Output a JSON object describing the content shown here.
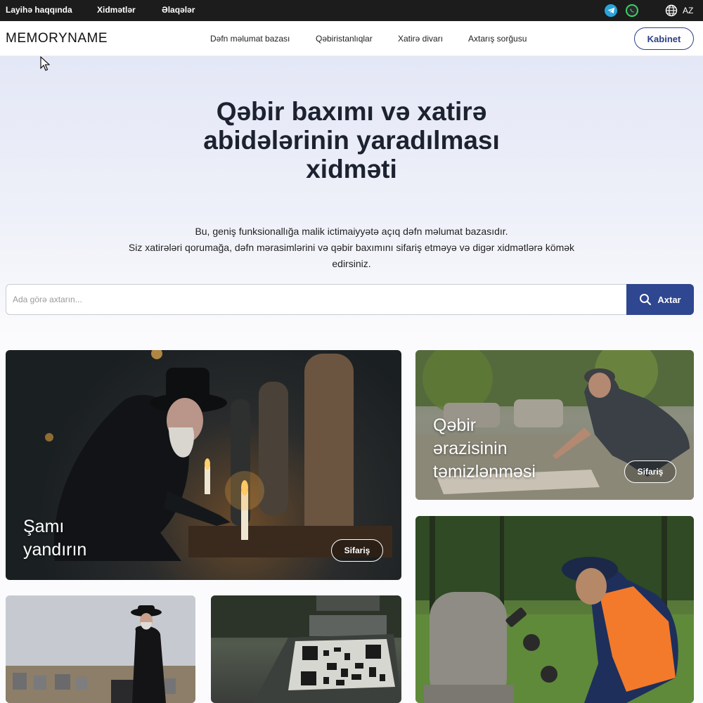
{
  "topbar": {
    "links": [
      "Layihə haqqında",
      "Xidmətlər",
      "Əlaqələr"
    ],
    "language": "AZ",
    "telegram_color": "#2aa3dc",
    "whatsapp_color": "#38d36a"
  },
  "header": {
    "logo": "MEMORYNAME",
    "nav": [
      "Dəfn məlumat bazası",
      "Qəbiristanlıqlar",
      "Xatirə divarı",
      "Axtarış sorğusu"
    ],
    "cabinet_label": "Kabinet",
    "accent_color": "#2b3f86"
  },
  "hero": {
    "title_lines": [
      "Qəbir baxımı və xatirə",
      "abidələrinin yaradılması",
      "xidməti"
    ],
    "description_lines": [
      "Bu, geniş funksionallığa malik ictimaiyyətə açıq dəfn məlumat bazasıdır.",
      "Siz xatirələri qorumağa, dəfn mərasimlərini və qəbir baxımını sifariş etməyə və digər xidmətlərə kömək",
      "edirsiniz."
    ],
    "search_placeholder": "Ada görə axtarın...",
    "search_button": "Axtar"
  },
  "cards": [
    {
      "title_lines": [
        "Şamı",
        "yandırın"
      ],
      "button": "Sifariş"
    },
    {
      "title_lines": [
        "Qəbir",
        "ərazisinin",
        "təmizlənməsi"
      ],
      "button": "Sifariş"
    }
  ]
}
